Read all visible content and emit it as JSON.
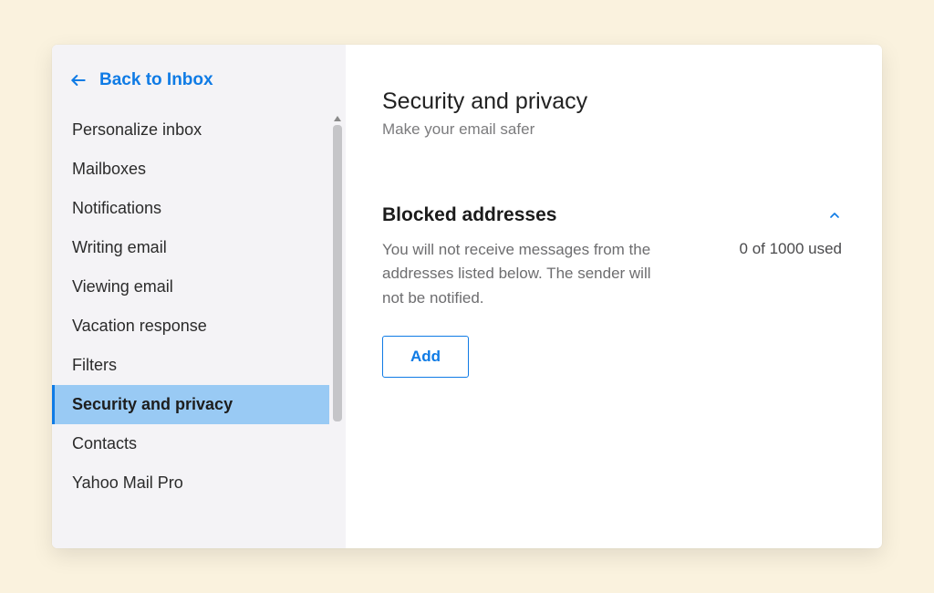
{
  "sidebar": {
    "back_label": "Back to Inbox",
    "items": [
      {
        "label": "Personalize inbox",
        "active": false
      },
      {
        "label": "Mailboxes",
        "active": false
      },
      {
        "label": "Notifications",
        "active": false
      },
      {
        "label": "Writing email",
        "active": false
      },
      {
        "label": "Viewing email",
        "active": false
      },
      {
        "label": "Vacation response",
        "active": false
      },
      {
        "label": "Filters",
        "active": false
      },
      {
        "label": "Security and privacy",
        "active": true
      },
      {
        "label": "Contacts",
        "active": false
      },
      {
        "label": "Yahoo Mail Pro",
        "active": false
      }
    ]
  },
  "main": {
    "title": "Security and privacy",
    "subtitle": "Make your email safer",
    "section": {
      "title": "Blocked addresses",
      "desc": "You will not receive messages from the addresses listed below. The sender will not be notified.",
      "usage": "0 of 1000 used",
      "add_label": "Add"
    }
  }
}
